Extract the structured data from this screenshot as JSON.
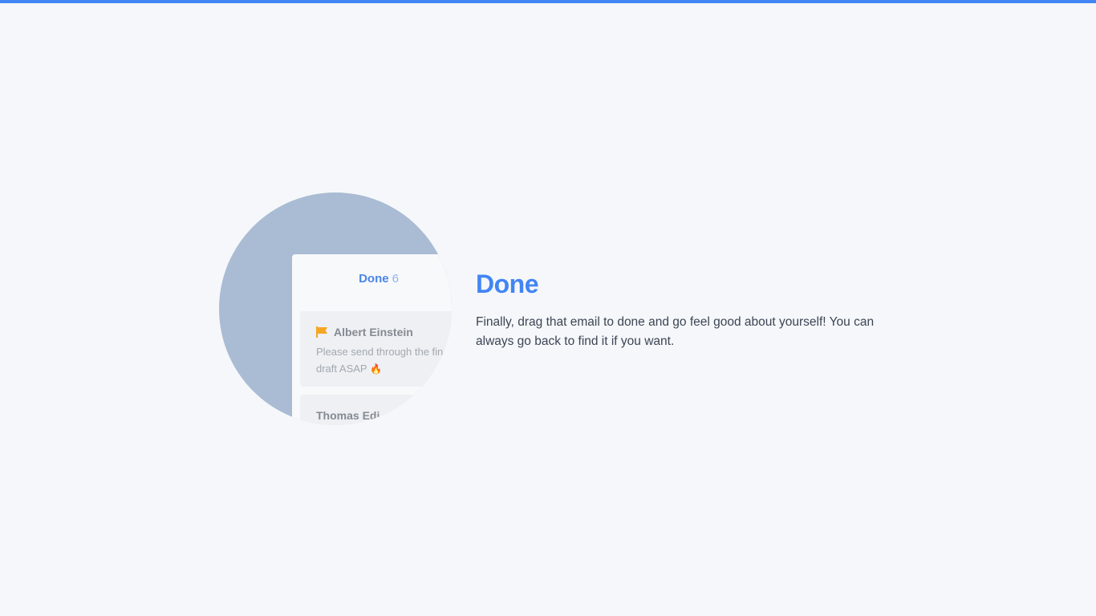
{
  "card": {
    "column_title": "Done",
    "column_count": "6",
    "emails": [
      {
        "sender": "Albert Einstein",
        "snippet": "Please send through the final draft ASAP",
        "icon": "flag-icon",
        "emoji": "🔥"
      },
      {
        "sender": "Thomas Edi"
      }
    ]
  },
  "content": {
    "title": "Done",
    "description": "Finally, drag that email to done and go feel good about yourself! You can always go back to find it if you want."
  },
  "colors": {
    "accent": "#4285f4",
    "circle": "#aabcd4",
    "flag": "#f5a623"
  }
}
